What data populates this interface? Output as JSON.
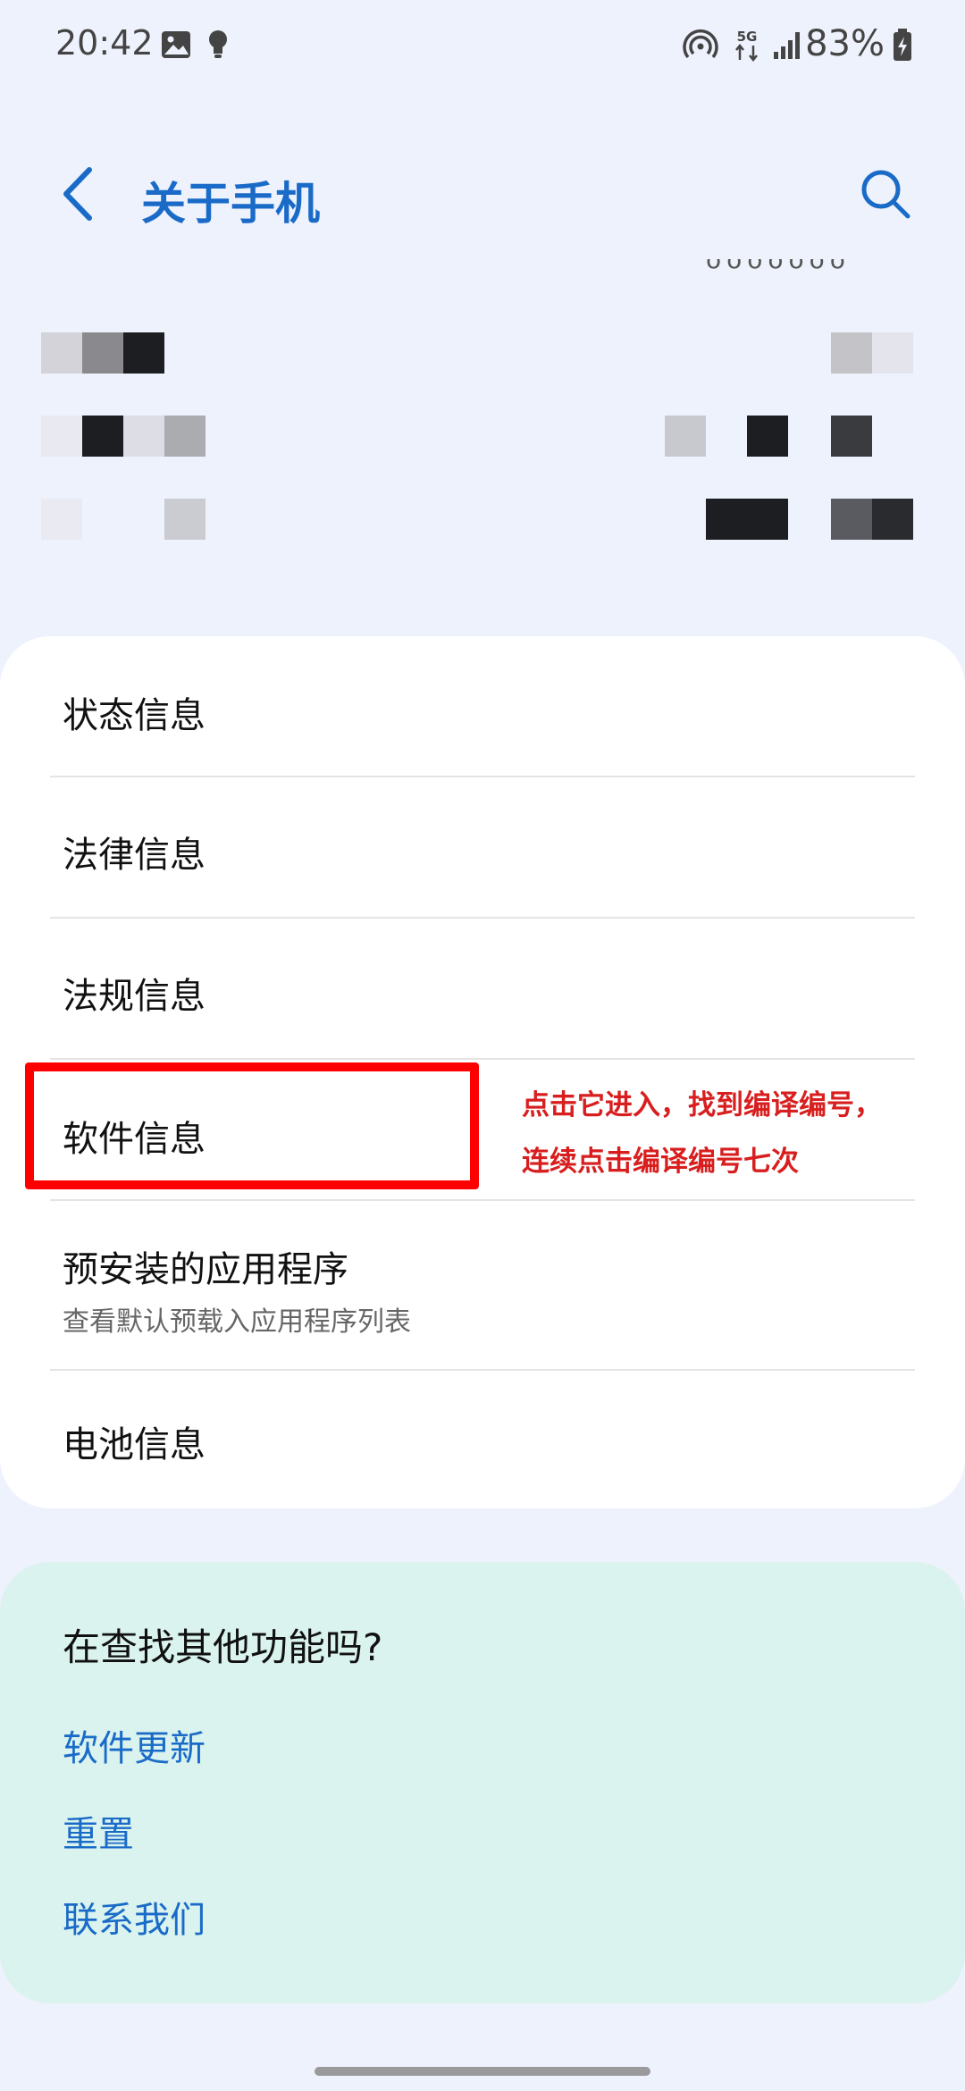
{
  "status_bar": {
    "time": "20:42",
    "battery": "83%",
    "network": "5G",
    "icons": [
      "image-icon",
      "bulb-icon",
      "hotspot-icon",
      "network-5g-icon",
      "signal-icon",
      "battery-charging-icon"
    ]
  },
  "header": {
    "title": "关于手机",
    "back_icon": "chevron-left-icon",
    "search_icon": "search-icon"
  },
  "settings": {
    "items": [
      {
        "title": "状态信息"
      },
      {
        "title": "法律信息"
      },
      {
        "title": "法规信息"
      },
      {
        "title": "软件信息"
      },
      {
        "title": "预安装的应用程序",
        "subtitle": "查看默认预载入应用程序列表"
      },
      {
        "title": "电池信息"
      }
    ]
  },
  "annotation": {
    "line1": "点击它进入，找到编译编号，",
    "line2": "连续点击编译编号七次"
  },
  "help": {
    "heading": "在查找其他功能吗?",
    "links": [
      "软件更新",
      "重置",
      "联系我们"
    ]
  },
  "colors": {
    "accent": "#1a6bc8",
    "highlight": "#ff0000",
    "annotation": "#d81e1e",
    "background": "#eef2fc",
    "help_card": "#daf3ee"
  }
}
